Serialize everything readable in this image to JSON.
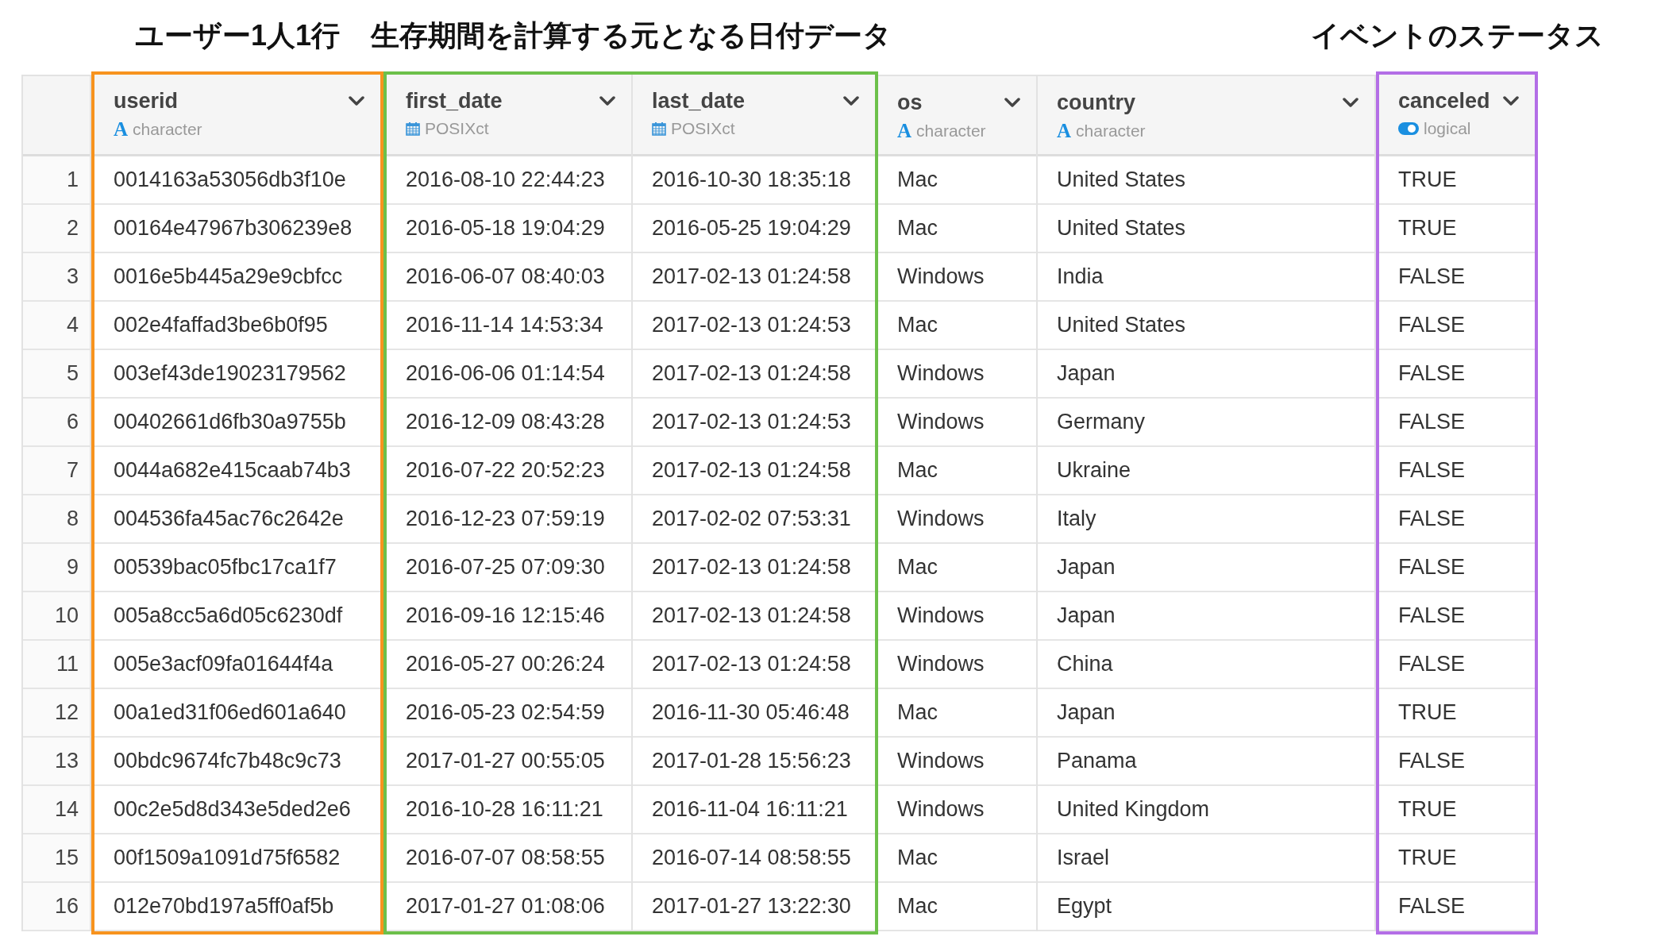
{
  "column_groups": [
    {
      "annotation": "ユーザー1人1行",
      "color": "#f7931e",
      "columns": [
        {
          "name": "userid",
          "type": "character",
          "kind": "letter",
          "icon_text": "A"
        }
      ]
    },
    {
      "annotation": "生存期間を計算する元となる日付データ",
      "color": "#6cc04a",
      "columns": [
        {
          "name": "first_date",
          "type": "POSIXct",
          "kind": "calendar"
        },
        {
          "name": "last_date",
          "type": "POSIXct",
          "kind": "calendar"
        }
      ]
    },
    {
      "columns": [
        {
          "name": "os",
          "type": "character",
          "kind": "letter",
          "icon_text": "A"
        },
        {
          "name": "country",
          "type": "character",
          "kind": "letter",
          "icon_text": "A"
        }
      ]
    },
    {
      "annotation": "イベントのステータス",
      "color": "#b36ee6",
      "columns": [
        {
          "name": "canceled",
          "type": "logical",
          "kind": "toggle"
        }
      ]
    }
  ],
  "rows": [
    {
      "number": "1",
      "cells": [
        "0014163a53056db3f10e",
        "2016-08-10 22:44:23",
        "2016-10-30 18:35:18",
        "Mac",
        "United States",
        "TRUE"
      ]
    },
    {
      "number": "2",
      "cells": [
        "00164e47967b306239e8",
        "2016-05-18 19:04:29",
        "2016-05-25 19:04:29",
        "Mac",
        "United States",
        "TRUE"
      ]
    },
    {
      "number": "3",
      "cells": [
        "0016e5b445a29e9cbfcc",
        "2016-06-07 08:40:03",
        "2017-02-13 01:24:58",
        "Windows",
        "India",
        "FALSE"
      ]
    },
    {
      "number": "4",
      "cells": [
        "002e4faffad3be6b0f95",
        "2016-11-14 14:53:34",
        "2017-02-13 01:24:53",
        "Mac",
        "United States",
        "FALSE"
      ]
    },
    {
      "number": "5",
      "cells": [
        "003ef43de19023179562",
        "2016-06-06 01:14:54",
        "2017-02-13 01:24:58",
        "Windows",
        "Japan",
        "FALSE"
      ]
    },
    {
      "number": "6",
      "cells": [
        "00402661d6fb30a9755b",
        "2016-12-09 08:43:28",
        "2017-02-13 01:24:53",
        "Windows",
        "Germany",
        "FALSE"
      ]
    },
    {
      "number": "7",
      "cells": [
        "0044a682e415caab74b3",
        "2016-07-22 20:52:23",
        "2017-02-13 01:24:58",
        "Mac",
        "Ukraine",
        "FALSE"
      ]
    },
    {
      "number": "8",
      "cells": [
        "004536fa45ac76c2642e",
        "2016-12-23 07:59:19",
        "2017-02-02 07:53:31",
        "Windows",
        "Italy",
        "FALSE"
      ]
    },
    {
      "number": "9",
      "cells": [
        "00539bac05fbc17ca1f7",
        "2016-07-25 07:09:30",
        "2017-02-13 01:24:58",
        "Mac",
        "Japan",
        "FALSE"
      ]
    },
    {
      "number": "10",
      "cells": [
        "005a8cc5a6d05c6230df",
        "2016-09-16 12:15:46",
        "2017-02-13 01:24:58",
        "Windows",
        "Japan",
        "FALSE"
      ]
    },
    {
      "number": "11",
      "cells": [
        "005e3acf09fa01644f4a",
        "2016-05-27 00:26:24",
        "2017-02-13 01:24:58",
        "Windows",
        "China",
        "FALSE"
      ]
    },
    {
      "number": "12",
      "cells": [
        "00a1ed31f06ed601a640",
        "2016-05-23 02:54:59",
        "2016-11-30 05:46:48",
        "Mac",
        "Japan",
        "TRUE"
      ]
    },
    {
      "number": "13",
      "cells": [
        "00bdc9674fc7b48c9c73",
        "2017-01-27 00:55:05",
        "2017-01-28 15:56:23",
        "Windows",
        "Panama",
        "FALSE"
      ]
    },
    {
      "number": "14",
      "cells": [
        "00c2e5d8d343e5ded2e6",
        "2016-10-28 16:11:21",
        "2016-11-04 16:11:21",
        "Windows",
        "United Kingdom",
        "TRUE"
      ]
    },
    {
      "number": "15",
      "cells": [
        "00f1509a1091d75f6582",
        "2016-07-07 08:58:55",
        "2016-07-14 08:58:55",
        "Mac",
        "Israel",
        "TRUE"
      ]
    },
    {
      "number": "16",
      "cells": [
        "012e70bd197a5ff0af5b",
        "2017-01-27 01:08:06",
        "2017-01-27 13:22:30",
        "Mac",
        "Egypt",
        "FALSE"
      ]
    }
  ]
}
